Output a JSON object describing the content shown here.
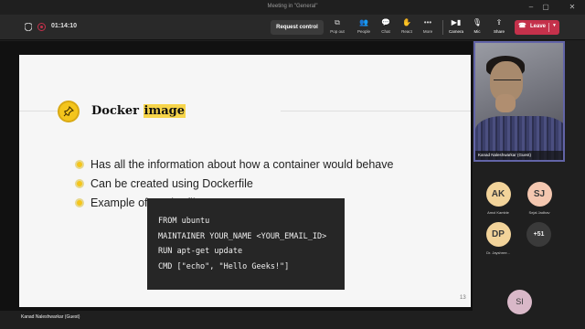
{
  "window": {
    "title": "Meeting in \"General\""
  },
  "toolbar": {
    "timer": "01:14:10",
    "request_control": "Request control",
    "buttons": [
      {
        "label": "Pop out",
        "icon": "popout-icon"
      },
      {
        "label": "People",
        "icon": "people-icon"
      },
      {
        "label": "Chat",
        "icon": "chat-icon"
      },
      {
        "label": "React",
        "icon": "react-icon"
      },
      {
        "label": "More",
        "icon": "more-icon"
      },
      {
        "label": "Camera",
        "icon": "camera-icon"
      },
      {
        "label": "Mic",
        "icon": "mic-icon"
      },
      {
        "label": "Share",
        "icon": "share-icon"
      }
    ],
    "leave": "Leave",
    "leave_color": "#c4314b"
  },
  "slide": {
    "title_plain": "Docker",
    "title_highlight": "image",
    "bullets": [
      "Has all the information about how a container would behave",
      "Can be created using Dockerfile",
      "Example of Dockerfile:"
    ],
    "code": [
      "FROM ubuntu",
      "MAINTAINER YOUR_NAME <YOUR_EMAIL_ID>",
      "RUN apt-get update",
      "CMD [\"echo\", \"Hello Geeks!\"]"
    ],
    "page_number": "13",
    "accent_color": "#f4c51c"
  },
  "presenter_name": "Kanad Naleshwarkar (Guest)",
  "video": {
    "name": "Kanad Naleshwarkar (Guest)"
  },
  "participants": [
    {
      "initials": "AK",
      "name": "Amol Kamble",
      "color": "#f2d39a"
    },
    {
      "initials": "SJ",
      "name": "Sejal Jadhav",
      "color": "#f4c7b0"
    },
    {
      "initials": "DP",
      "name": "Dr. Jayshree...",
      "color": "#f2d39a"
    }
  ],
  "more_count": "+51",
  "self_initials": "SI"
}
